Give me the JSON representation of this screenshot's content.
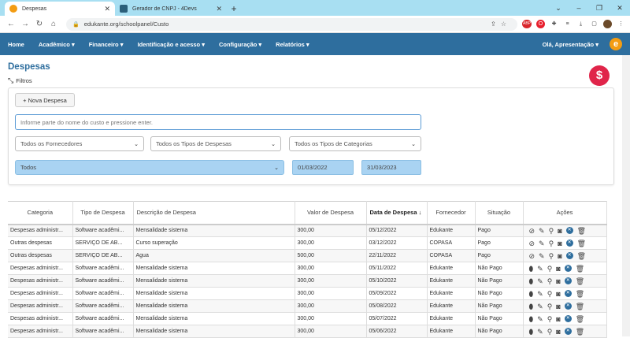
{
  "browser": {
    "tabs": [
      {
        "title": "Despesas",
        "active": true
      },
      {
        "title": "Gerador de CNPJ - 4Devs",
        "active": false
      }
    ],
    "url": "edukante.org/schoolpanel/Custo"
  },
  "nav": {
    "items": [
      "Home",
      "Acadêmico ▾",
      "Financeiro ▾",
      "Identificação e acesso ▾",
      "Configuração ▾",
      "Relatórios ▾"
    ],
    "user": "Olá, Apresentação ▾",
    "logo": "e"
  },
  "page": {
    "title": "Despesas",
    "filters_label": "Filtros",
    "new_button": "+ Nova Despesa",
    "search_placeholder": "Informe parte do nome do custo e pressione enter.",
    "fornecedor_select": "Todos os Fornecedores",
    "tipo_select": "Todos os Tipos de Despesas",
    "categoria_select": "Todos os Tipos de Categorias",
    "status_select": "Todos",
    "date_from": "01/03/2022",
    "date_to": "31/03/2023"
  },
  "table": {
    "headers": [
      "Categoria",
      "Tipo de Despesa",
      "Descrição de Despesa",
      "Valor de Despesa",
      "Data de Despesa ↓",
      "Fornecedor",
      "Situação",
      "Ações"
    ],
    "rows": [
      [
        "Despesas administr...",
        "Software acadêmi...",
        "Mensalidade sistema",
        "300,00",
        "05/12/2022",
        "Edukante",
        "Pago"
      ],
      [
        "Outras despesas",
        "SERVIÇO DE AB...",
        "Curso superação",
        "300,00",
        "03/12/2022",
        "COPASA",
        "Pago"
      ],
      [
        "Outras despesas",
        "SERVIÇO DE AB...",
        "Agua",
        "500,00",
        "22/11/2022",
        "COPASA",
        "Pago"
      ],
      [
        "Despesas administr...",
        "Software acadêmi...",
        "Mensalidade sistema",
        "300,00",
        "05/11/2022",
        "Edukante",
        "Não Pago"
      ],
      [
        "Despesas administr...",
        "Software acadêmi...",
        "Mensalidade sistema",
        "300,00",
        "05/10/2022",
        "Edukante",
        "Não Pago"
      ],
      [
        "Despesas administr...",
        "Software acadêmi...",
        "Mensalidade sistema",
        "300,00",
        "05/09/2022",
        "Edukante",
        "Não Pago"
      ],
      [
        "Despesas administr...",
        "Software acadêmi...",
        "Mensalidade sistema",
        "300,00",
        "05/08/2022",
        "Edukante",
        "Não Pago"
      ],
      [
        "Despesas administr...",
        "Software acadêmi...",
        "Mensalidade sistema",
        "300,00",
        "05/07/2022",
        "Edukante",
        "Não Pago"
      ],
      [
        "Despesas administr...",
        "Software acadêmi...",
        "Mensalidade sistema",
        "300,00",
        "05/06/2022",
        "Edukante",
        "Não Pago"
      ]
    ]
  }
}
